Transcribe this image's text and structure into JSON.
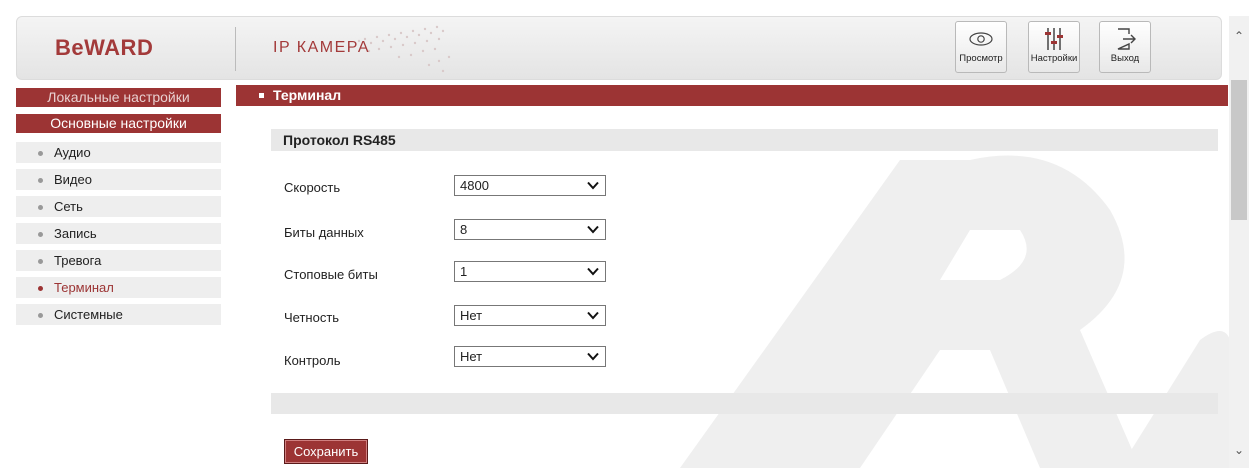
{
  "header": {
    "logo": "BeWARD",
    "subtitle": "IP КАМЕРА",
    "buttons": [
      {
        "label": "Просмотр",
        "icon": "eye-icon"
      },
      {
        "label": "Настройки",
        "icon": "sliders-icon"
      },
      {
        "label": "Выход",
        "icon": "exit-icon"
      }
    ]
  },
  "sidebar": {
    "local_settings": "Локальные настройки",
    "main_settings": "Основные настройки",
    "items": [
      {
        "label": "Аудио",
        "active": false
      },
      {
        "label": "Видео",
        "active": false
      },
      {
        "label": "Сеть",
        "active": false
      },
      {
        "label": "Запись",
        "active": false
      },
      {
        "label": "Тревога",
        "active": false
      },
      {
        "label": "Терминал",
        "active": true
      },
      {
        "label": "Системные",
        "active": false
      }
    ]
  },
  "content": {
    "title": "Терминал",
    "section_title": "Протокол RS485",
    "fields": [
      {
        "label": "Скорость",
        "value": "4800"
      },
      {
        "label": "Биты данных",
        "value": "8"
      },
      {
        "label": "Стоповые биты",
        "value": "1"
      },
      {
        "label": "Четность",
        "value": "Нет"
      },
      {
        "label": "Контроль",
        "value": "Нет"
      }
    ],
    "save_label": "Сохранить"
  },
  "colors": {
    "accent": "#9c3434",
    "panel": "#e8e8e8"
  }
}
